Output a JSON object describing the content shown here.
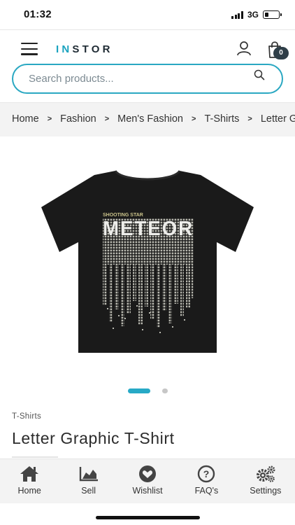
{
  "status_bar": {
    "time": "01:32",
    "network": "3G",
    "battery_level": 0.3
  },
  "header": {
    "logo_prefix": "IN",
    "logo_suffix": "STOR",
    "cart_count": "0",
    "icons": [
      "menu-icon",
      "account-icon",
      "cart-icon"
    ]
  },
  "search": {
    "placeholder": "Search products..."
  },
  "breadcrumb": {
    "items": [
      "Home",
      "Fashion",
      "Men's Fashion",
      "T-Shirts",
      "Letter Graphic T-Shirt"
    ]
  },
  "product": {
    "image_semantic": "black t-shirt with graphic print",
    "graphic_top_text": "SHOOTING STAR",
    "graphic_main_text": "METEOR",
    "gallery": {
      "total": 2,
      "active_index": 0
    },
    "category": "T-Shirts",
    "title": "Letter Graphic T-Shirt"
  },
  "bottom_nav": {
    "items": [
      {
        "label": "Home",
        "icon": "home-icon"
      },
      {
        "label": "Sell",
        "icon": "chart-icon"
      },
      {
        "label": "Wishlist",
        "icon": "heart-icon"
      },
      {
        "label": "FAQ's",
        "icon": "question-icon"
      },
      {
        "label": "Settings",
        "icon": "gears-icon"
      }
    ]
  },
  "colors": {
    "accent": "#27a9c6",
    "logo_dark": "#1e2a33",
    "badge": "#2f3e48",
    "shirt": "#1a1a1a",
    "print": "#b9b9b0"
  }
}
